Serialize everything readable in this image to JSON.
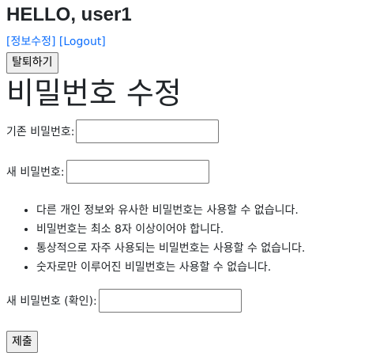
{
  "header": {
    "greeting": "HELLO, user1",
    "edit_link": "[정보수정]",
    "logout_link": "[Logout]"
  },
  "withdraw_button": "탈퇴하기",
  "page_title": "비밀번호 수정",
  "form": {
    "current_password_label": "기존 비밀번호:",
    "current_password_value": "",
    "new_password_label": "새 비밀번호:",
    "new_password_value": "",
    "rules": [
      "다른 개인 정보와 유사한 비밀번호는 사용할 수 없습니다.",
      "비밀번호는 최소 8자 이상이어야 합니다.",
      "통상적으로 자주 사용되는 비밀번호는 사용할 수 없습니다.",
      "숫자로만 이루어진 비밀번호는 사용할 수 없습니다."
    ],
    "confirm_password_label": "새 비밀번호 (확인):",
    "confirm_password_value": "",
    "submit_button": "제출"
  },
  "colors": {
    "link": "#0d6efd",
    "text": "#212529"
  }
}
